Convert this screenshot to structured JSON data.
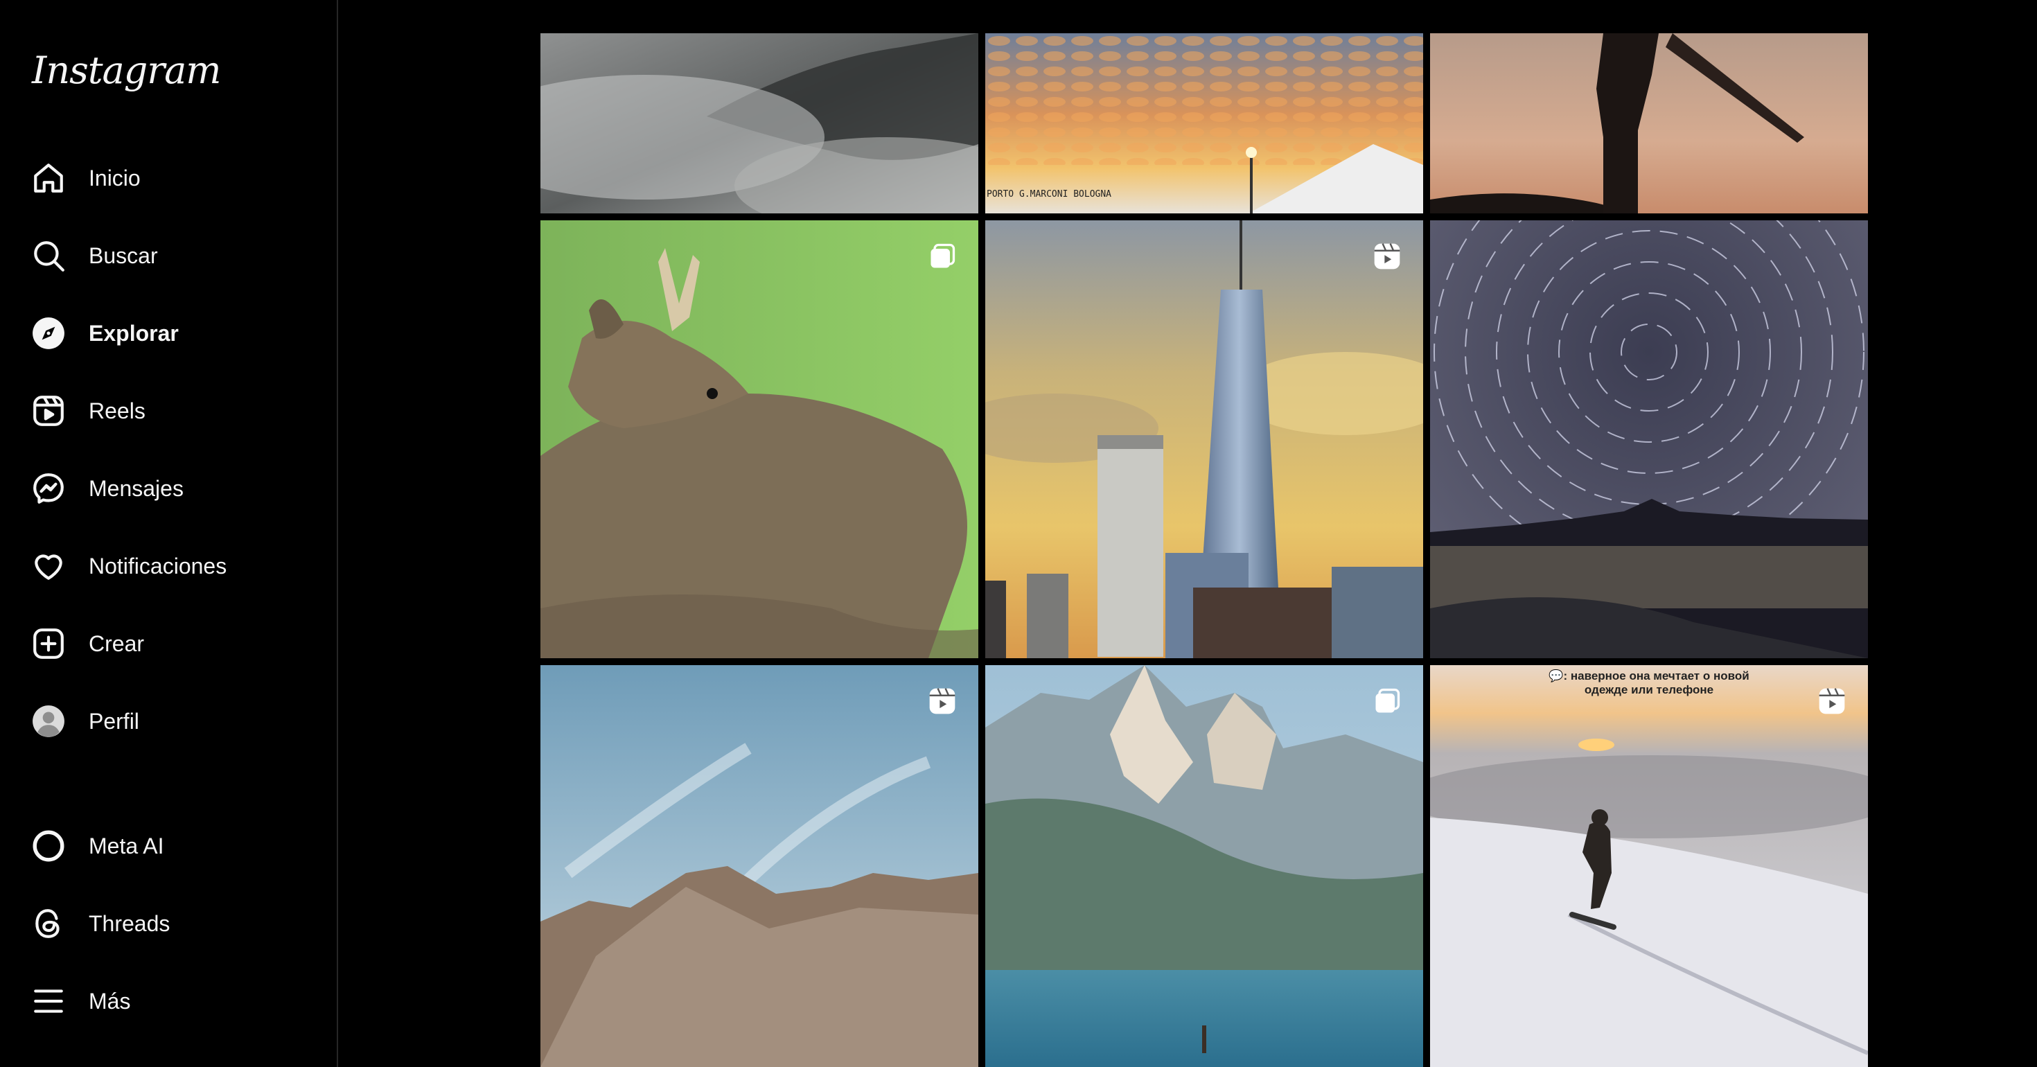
{
  "app": {
    "logo": "Instagram"
  },
  "sidebar": {
    "items": [
      {
        "label": "Inicio",
        "icon": "home-icon"
      },
      {
        "label": "Buscar",
        "icon": "search-icon"
      },
      {
        "label": "Explorar",
        "icon": "compass-icon",
        "active": true
      },
      {
        "label": "Reels",
        "icon": "reels-icon"
      },
      {
        "label": "Mensajes",
        "icon": "messenger-icon"
      },
      {
        "label": "Notificaciones",
        "icon": "heart-icon"
      },
      {
        "label": "Crear",
        "icon": "plus-square-icon"
      },
      {
        "label": "Perfil",
        "icon": "avatar-icon"
      }
    ],
    "bottom_items": [
      {
        "label": "Meta AI",
        "icon": "meta-ai-icon"
      },
      {
        "label": "Threads",
        "icon": "threads-icon"
      },
      {
        "label": "Más",
        "icon": "menu-icon"
      }
    ]
  },
  "explore": {
    "tiles": [
      {
        "subject": "fog over forest",
        "badge": null
      },
      {
        "subject": "sunset clouds over airport",
        "badge": null,
        "sign_text": "PORTO G.MARCONI BOLOGNA"
      },
      {
        "subject": "surfer silhouette at dusk",
        "badge": null
      },
      {
        "subject": "roe deer",
        "badge": "carousel-icon"
      },
      {
        "subject": "One World Trade Center skyline",
        "badge": "reels-icon"
      },
      {
        "subject": "star trails over lake",
        "badge": null
      },
      {
        "subject": "rocky mountain under sky",
        "badge": "reels-icon"
      },
      {
        "subject": "Torres del Paine mountains and lake",
        "badge": "carousel-icon"
      },
      {
        "subject": "snowboarder above clouds",
        "badge": "reels-icon",
        "caption": "💬: наверное она мечтает о новой\nодежде или телефоне"
      }
    ]
  },
  "colors": {
    "background": "#000000",
    "text": "#f5f5f5",
    "border": "#262626"
  }
}
